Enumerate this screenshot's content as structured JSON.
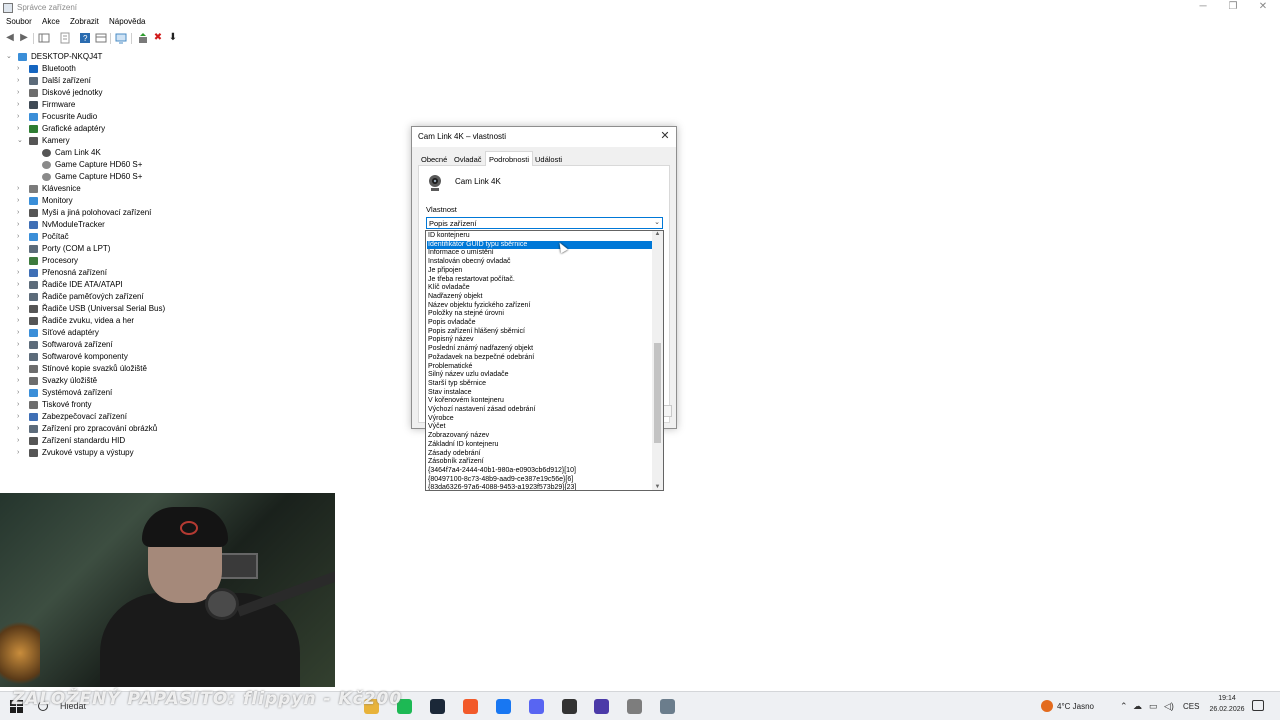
{
  "window": {
    "title": "Správce zařízení",
    "min_glyph": "─",
    "max_glyph": "❐",
    "close_glyph": "✕"
  },
  "menu": [
    "Soubor",
    "Akce",
    "Zobrazit",
    "Nápověda"
  ],
  "toolbar": {
    "back_glyph": "◀",
    "forward_glyph": "▶",
    "delete_glyph": "✖",
    "download_glyph": "⬇"
  },
  "tree": {
    "root": "DESKTOP-NKQJ4T",
    "items": [
      {
        "label": "Bluetooth",
        "expanded": false,
        "color": "#1565c0"
      },
      {
        "label": "Další zařízení",
        "expanded": false,
        "color": "#5c6b7a"
      },
      {
        "label": "Diskové jednotky",
        "expanded": false,
        "color": "#6d6d6d"
      },
      {
        "label": "Firmware",
        "expanded": false,
        "color": "#3f4a55"
      },
      {
        "label": "Focusrite Audio",
        "expanded": false,
        "color": "#3a8ed8"
      },
      {
        "label": "Grafické adaptéry",
        "expanded": false,
        "color": "#2e7d32"
      },
      {
        "label": "Kamery",
        "expanded": true,
        "color": "#555555"
      },
      {
        "label": "Klávesnice",
        "expanded": false,
        "color": "#7b7b7b"
      },
      {
        "label": "Monitory",
        "expanded": false,
        "color": "#3a8ed8"
      },
      {
        "label": "Myši a jiná polohovací zařízení",
        "expanded": false,
        "color": "#555555"
      },
      {
        "label": "NvModuleTracker",
        "expanded": false,
        "color": "#3f6fb5"
      },
      {
        "label": "Počítač",
        "expanded": false,
        "color": "#3a8ed8"
      },
      {
        "label": "Porty (COM a LPT)",
        "expanded": false,
        "color": "#5c6b7a"
      },
      {
        "label": "Procesory",
        "expanded": false,
        "color": "#3d7a3d"
      },
      {
        "label": "Přenosná zařízení",
        "expanded": false,
        "color": "#3f6fb5"
      },
      {
        "label": "Řadiče IDE ATA/ATAPI",
        "expanded": false,
        "color": "#5c6b7a"
      },
      {
        "label": "Řadiče paměťových zařízení",
        "expanded": false,
        "color": "#5c6b7a"
      },
      {
        "label": "Řadiče USB (Universal Serial Bus)",
        "expanded": false,
        "color": "#555555"
      },
      {
        "label": "Řadiče zvuku, videa a her",
        "expanded": false,
        "color": "#555555"
      },
      {
        "label": "Síťové adaptéry",
        "expanded": false,
        "color": "#3a8ed8"
      },
      {
        "label": "Softwarová zařízení",
        "expanded": false,
        "color": "#5c6b7a"
      },
      {
        "label": "Softwarové komponenty",
        "expanded": false,
        "color": "#5c6b7a"
      },
      {
        "label": "Stínové kopie svazků úložiště",
        "expanded": false,
        "color": "#6d6d6d"
      },
      {
        "label": "Svazky úložiště",
        "expanded": false,
        "color": "#6d6d6d"
      },
      {
        "label": "Systémová zařízení",
        "expanded": false,
        "color": "#3a8ed8"
      },
      {
        "label": "Tiskové fronty",
        "expanded": false,
        "color": "#6d6d6d"
      },
      {
        "label": "Zabezpečovací zařízení",
        "expanded": false,
        "color": "#3f6fb5"
      },
      {
        "label": "Zařízení pro zpracování obrázků",
        "expanded": false,
        "color": "#5c6b7a"
      },
      {
        "label": "Zařízení standardu HID",
        "expanded": false,
        "color": "#555555"
      },
      {
        "label": "Zvukové vstupy a výstupy",
        "expanded": false,
        "color": "#555555"
      }
    ],
    "cameras": [
      "Cam Link 4K",
      "Game Capture HD60 S+",
      "Game Capture HD60 S+"
    ]
  },
  "dialog": {
    "title": "Cam Link 4K – vlastnosti",
    "tabs": [
      "Obecné",
      "Ovladač",
      "Podrobnosti",
      "Události"
    ],
    "active_tab": "Podrobnosti",
    "device_name": "Cam Link 4K",
    "property_label": "Vlastnost",
    "property_value": "Popis zařízení",
    "dropdown_items": [
      "ID kontejneru",
      "Identifikátor GUID typu sběrnice",
      "Informace o umístění",
      "Instalován obecný ovladač",
      "Je připojen",
      "Je třeba restartovat počítač.",
      "Klíč ovladače",
      "Nadřazený objekt",
      "Název objektu fyzického zařízení",
      "Položky na stejné úrovni",
      "Popis ovladače",
      "Popis zařízení hlášený sběrnicí",
      "Popisný název",
      "Poslední známý nadřazený objekt",
      "Požadavek na bezpečné odebrání",
      "Problematické",
      "Silný název uzlu ovladače",
      "Starší typ sběrnice",
      "Stav instalace",
      "V kořenovém kontejneru",
      "Výchozí nastavení zásad odebrání",
      "Výrobce",
      "Výčet",
      "Zobrazovaný název",
      "Základní ID kontejneru",
      "Zásady odebrání",
      "Zásobník zařízení",
      "{3464f7a4-2444-40b1-980a-e0903cb6d912}[10]",
      "{80497100-8c73-48b9-aad9-ce387e19c56e}[6]",
      "{83da6326-97a6-4088-9453-a1923f573b29}[23]"
    ],
    "selected_index": 1
  },
  "overlay": {
    "text": "ZALOŽENÝ PAPASITO: flippyn - Kč200"
  },
  "taskbar": {
    "search": "Hledat",
    "apps": [
      {
        "name": "file-explorer-icon",
        "color": "#e8b33a"
      },
      {
        "name": "spotify-icon",
        "color": "#1db954"
      },
      {
        "name": "steam-icon",
        "color": "#1b2838"
      },
      {
        "name": "brave-icon",
        "color": "#f25a2a"
      },
      {
        "name": "messenger-icon",
        "color": "#1877f2"
      },
      {
        "name": "discord-icon",
        "color": "#5865f2"
      },
      {
        "name": "app-icon",
        "color": "#333333"
      },
      {
        "name": "obs-icon",
        "color": "#4b3aa8"
      },
      {
        "name": "document-icon",
        "color": "#7d7d7d"
      },
      {
        "name": "device-manager-icon",
        "color": "#6b7d8c"
      }
    ],
    "temperature": "4°C  Jasno",
    "tray_up_glyph": "⌃",
    "language": "CES",
    "time": "19:14",
    "date": "26.02.2026"
  }
}
